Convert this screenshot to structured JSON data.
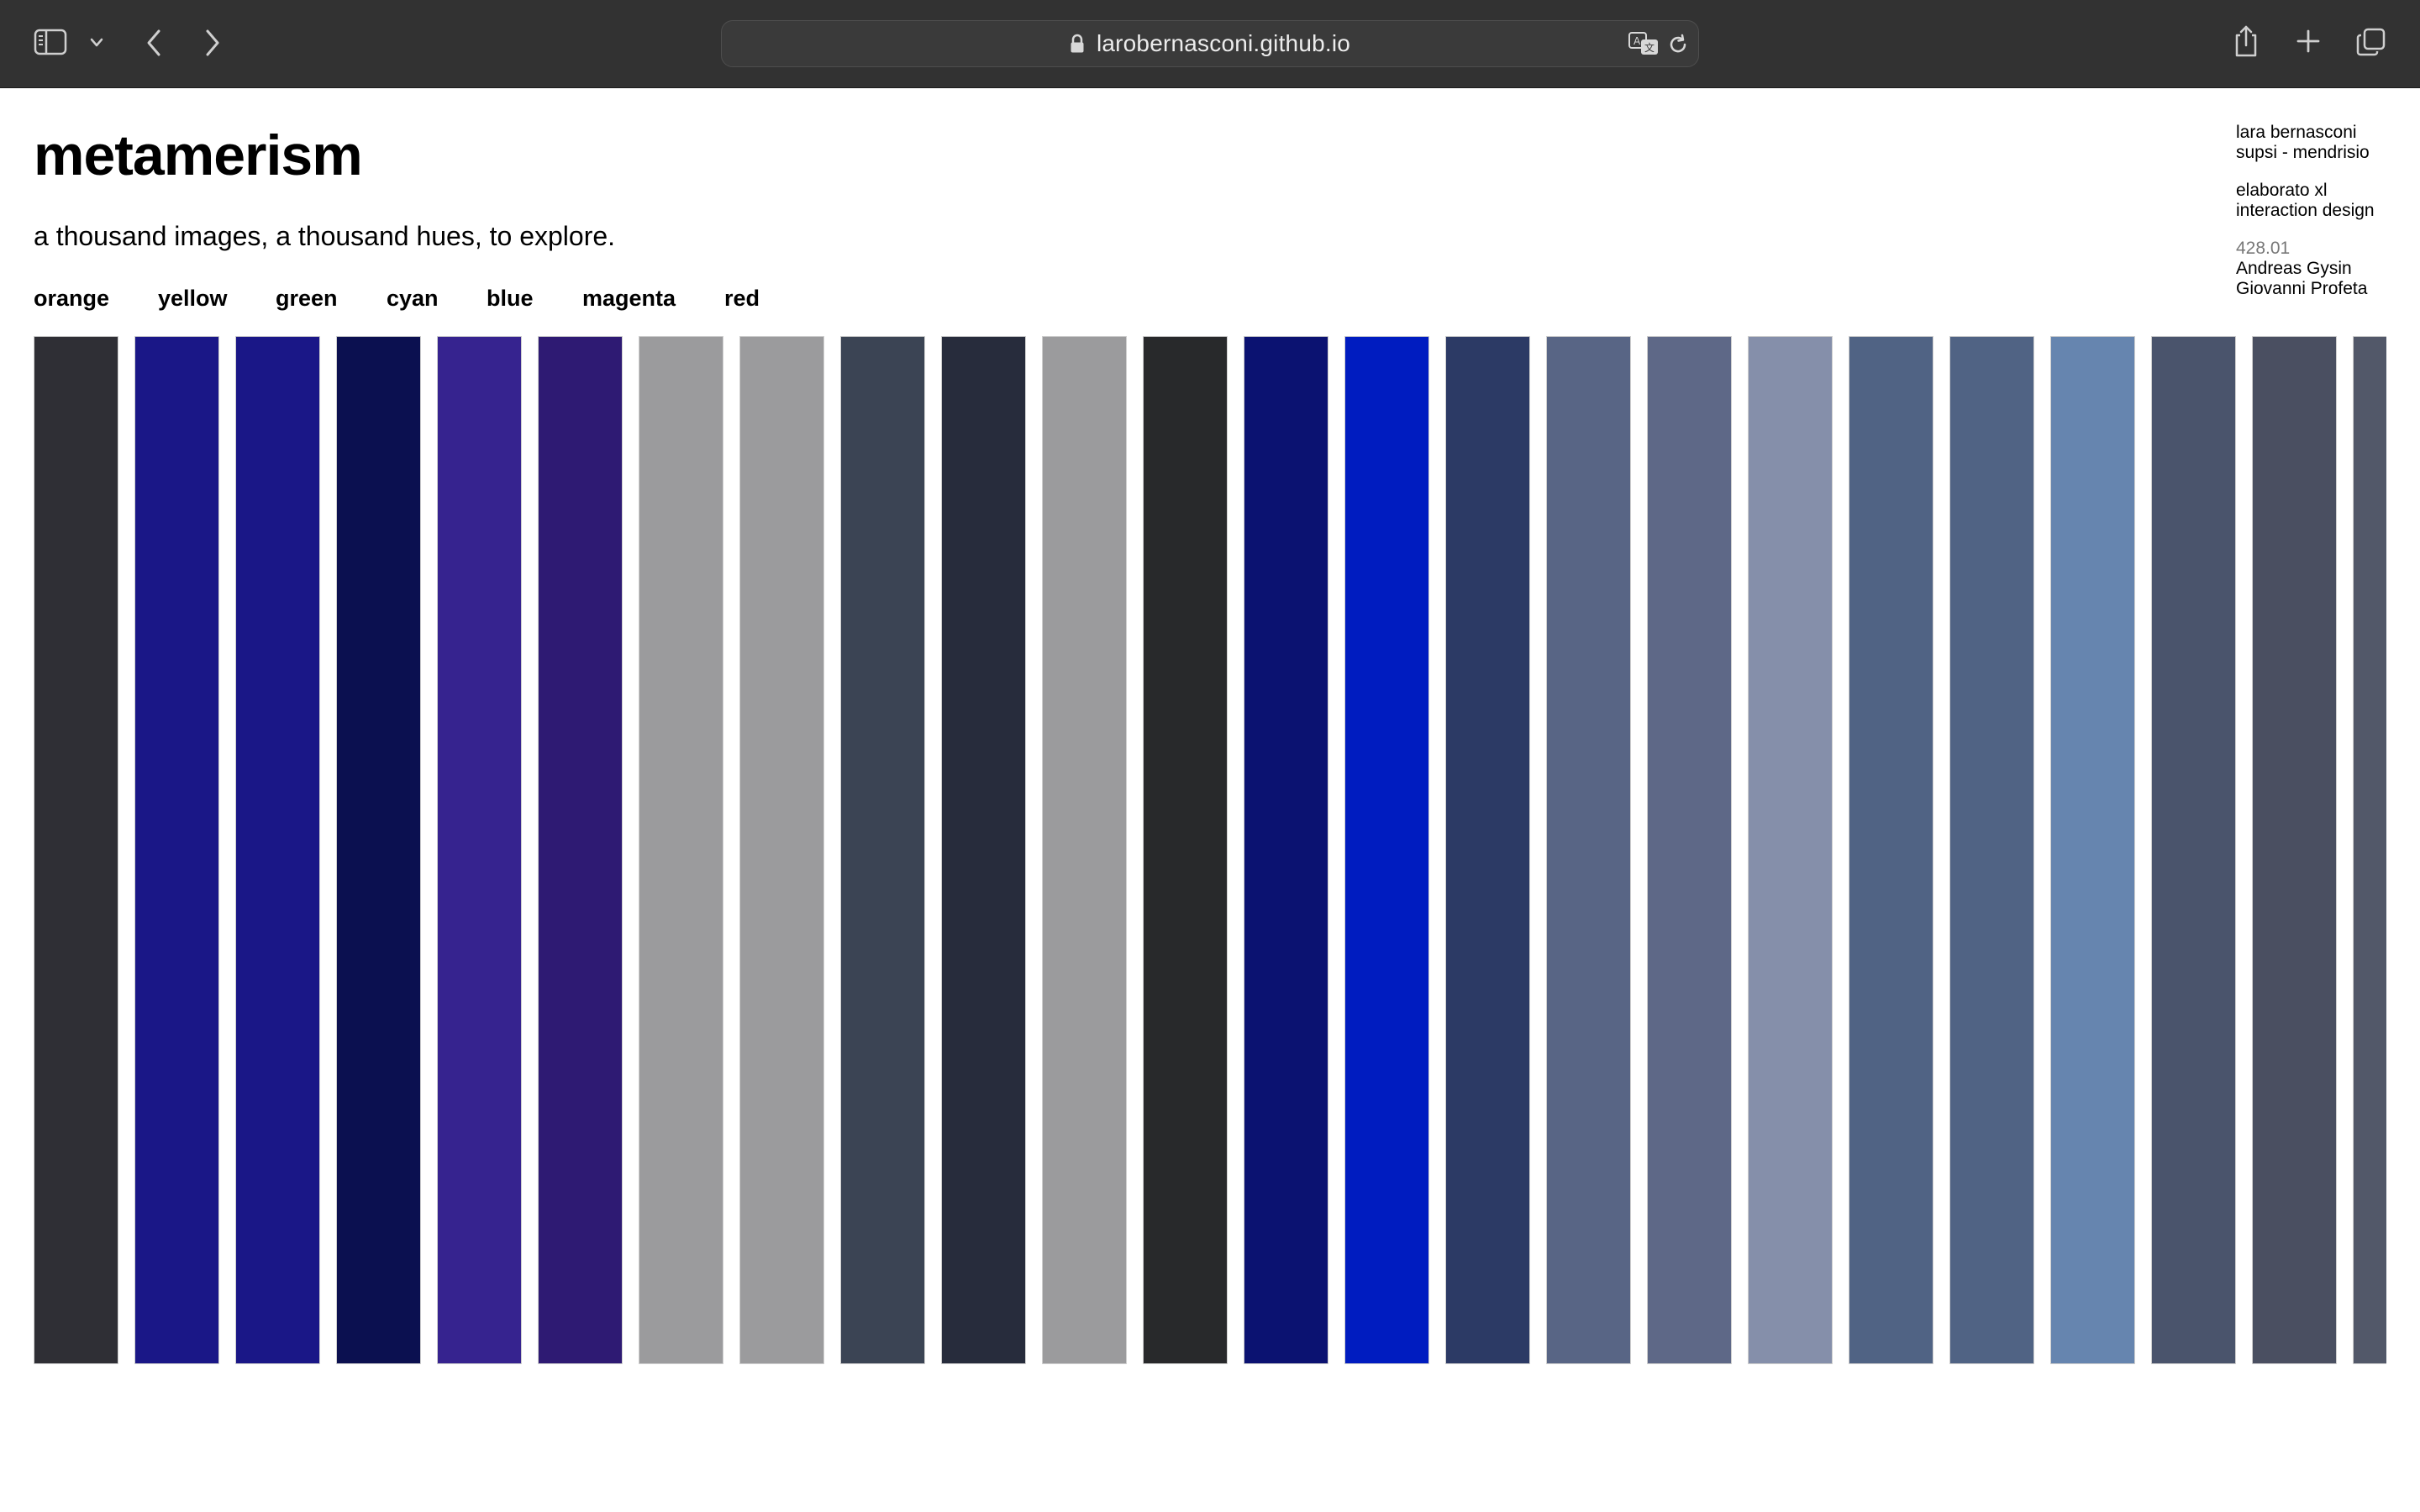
{
  "browser": {
    "url": "larobernasconi.github.io",
    "icons": [
      "sidebar-toggle-icon",
      "chevron-down-icon",
      "back-arrow-icon",
      "forward-arrow-icon",
      "lock-icon",
      "translate-icon",
      "reload-icon",
      "share-icon",
      "plus-icon",
      "tabs-overview-icon"
    ]
  },
  "header": {
    "title": "metamerism",
    "subtitle": "a thousand images, a thousand hues, to explore."
  },
  "filters": [
    {
      "label": "orange"
    },
    {
      "label": "yellow"
    },
    {
      "label": "green"
    },
    {
      "label": "cyan"
    },
    {
      "label": "blue"
    },
    {
      "label": "magenta"
    },
    {
      "label": "red"
    }
  ],
  "credits": {
    "author": "lara bernasconi",
    "school": "supsi - mendrisio",
    "project": "elaborato xl",
    "program": "interaction design",
    "course": "428.01",
    "tutor1": "Andreas Gysin",
    "tutor2": "Giovanni Profeta"
  },
  "swatches": [
    "#2f2f35",
    "#1a1787",
    "#1a1787",
    "#0b1050",
    "#36238f",
    "#2e1a73",
    "#9b9b9d",
    "#9b9b9d",
    "#3b4454",
    "#272c3c",
    "#9b9b9d",
    "#28292b",
    "#0b1271",
    "#001cc0",
    "#2c3a65",
    "#586585",
    "#5e6887",
    "#858faa",
    "#506384",
    "#506384",
    "#6685af",
    "#4a546c",
    "#4a4f61",
    "#525869"
  ]
}
